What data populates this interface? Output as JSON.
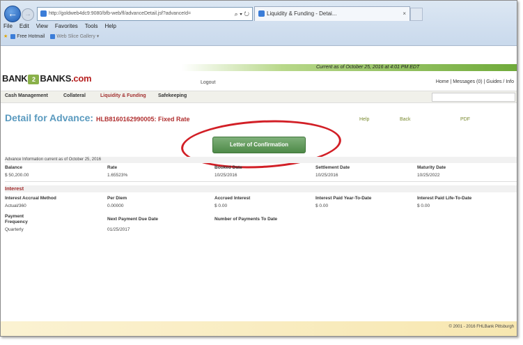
{
  "browser": {
    "address": "http://goldweb4dc9:9080/bfb-web/fl/advanceDetail.jsf?advanceId=",
    "address_controls": "⌕ ▾ ↻",
    "tab_title": "Liquidity & Funding - Detai...",
    "menu": [
      "File",
      "Edit",
      "View",
      "Favorites",
      "Tools",
      "Help"
    ],
    "favorites": [
      "Free Hotmail",
      "Web Slice Gallery ▾"
    ]
  },
  "site": {
    "logo_left": "BANK",
    "logo_mid": "2",
    "logo_right": "BANKS",
    "logo_suffix": ".com",
    "logout": "Logout",
    "current_as_of": "Current as of October 25, 2016 at 4:01 PM EDT",
    "top_links": "Home | Messages (0) | Guides / Info",
    "nav": [
      "Cash Management",
      "Collateral",
      "Liquidity & Funding",
      "Safekeeping"
    ]
  },
  "detail": {
    "title": "Detail for Advance: ",
    "code": "HLB8160162990005: Fixed Rate",
    "help": "Help",
    "back": "Back",
    "pdf": "PDF",
    "letter_button": "Letter of Confirmation"
  },
  "info": {
    "caption": "Advance Information current as of October 25, 2016",
    "headers": [
      "Balance",
      "Rate",
      "Booked Date",
      "Settlement Date",
      "Maturity Date"
    ],
    "values": [
      "$ 50,200.00",
      "1.65523%",
      "10/25/2016",
      "10/25/2016",
      "10/25/2022"
    ]
  },
  "interest": {
    "section": "Interest",
    "headers1": [
      "Interest Accrual Method",
      "Per Diem",
      "Accrued Interest",
      "Interest Paid Year-To-Date",
      "Interest Paid Life-To-Date"
    ],
    "values1": [
      "Actual/360",
      "0.00000",
      "$ 0.00",
      "$ 0.00",
      "$ 0.00"
    ],
    "payment_frequency_label": "Payment Frequency",
    "next_payment_label": "Next Payment Due Date",
    "number_payments_label": "Number of Payments To Date",
    "payment_frequency_value": "Quarterly",
    "next_payment_value": "01/25/2017"
  },
  "footer": {
    "copyright": "© 2001 - 2016 FHLBank Pittsburgh"
  },
  "colors": {
    "title": "#5a9abf",
    "accent_red": "#d21f26",
    "button_green": "#4e8a48"
  }
}
